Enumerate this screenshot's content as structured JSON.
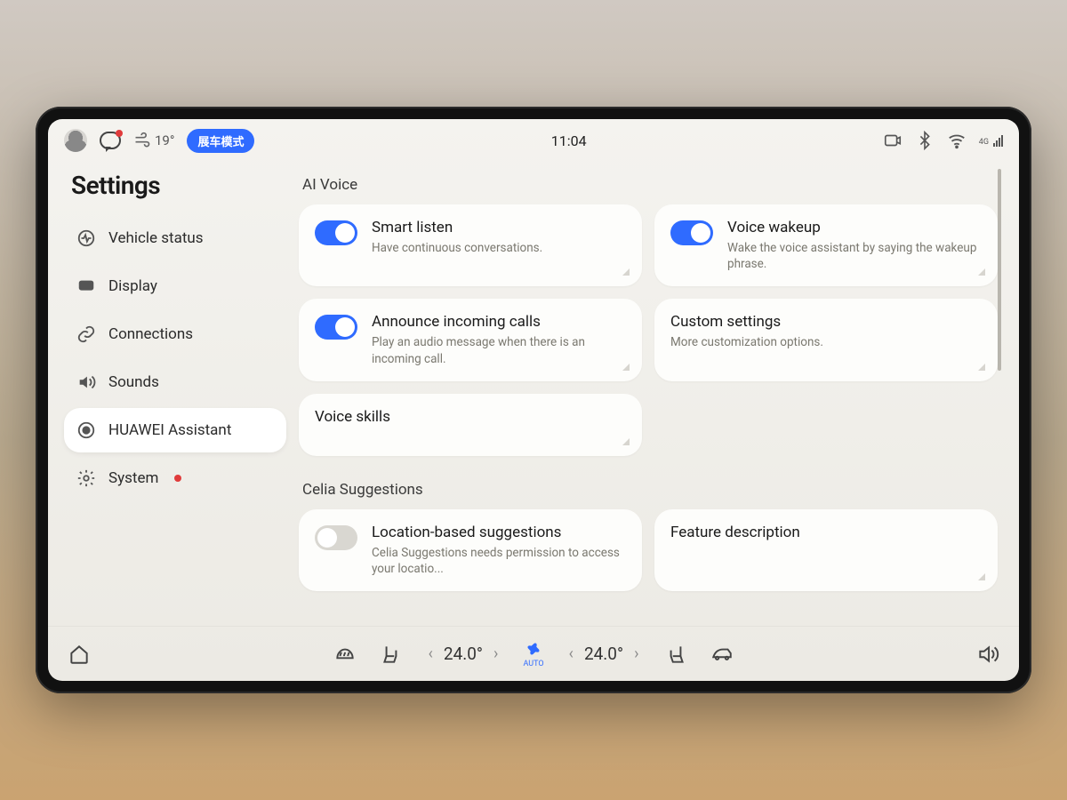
{
  "status": {
    "temperature": "19°",
    "mode_pill": "展车模式",
    "clock": "11:04",
    "network_label": "4G"
  },
  "sidebar": {
    "title": "Settings",
    "items": [
      {
        "label": "Vehicle status"
      },
      {
        "label": "Display"
      },
      {
        "label": "Connections"
      },
      {
        "label": "Sounds"
      },
      {
        "label": "HUAWEI Assistant"
      },
      {
        "label": "System"
      }
    ]
  },
  "sections": {
    "ai_voice": {
      "title": "AI Voice",
      "smart_listen": {
        "title": "Smart listen",
        "desc": "Have continuous conversations."
      },
      "voice_wakeup": {
        "title": "Voice wakeup",
        "desc": "Wake the voice assistant by saying the wakeup phrase."
      },
      "announce_calls": {
        "title": "Announce incoming calls",
        "desc": "Play an audio message when there is an incoming call."
      },
      "custom_settings": {
        "title": "Custom settings",
        "desc": "More customization options."
      },
      "voice_skills": {
        "title": "Voice skills"
      }
    },
    "celia": {
      "title": "Celia Suggestions",
      "location": {
        "title": "Location-based suggestions",
        "desc": "Celia Suggestions needs permission to access your locatio..."
      },
      "feature_desc": {
        "title": "Feature description"
      }
    }
  },
  "dock": {
    "temp_left": "24.0°",
    "temp_right": "24.0°",
    "fan_label": "AUTO"
  }
}
